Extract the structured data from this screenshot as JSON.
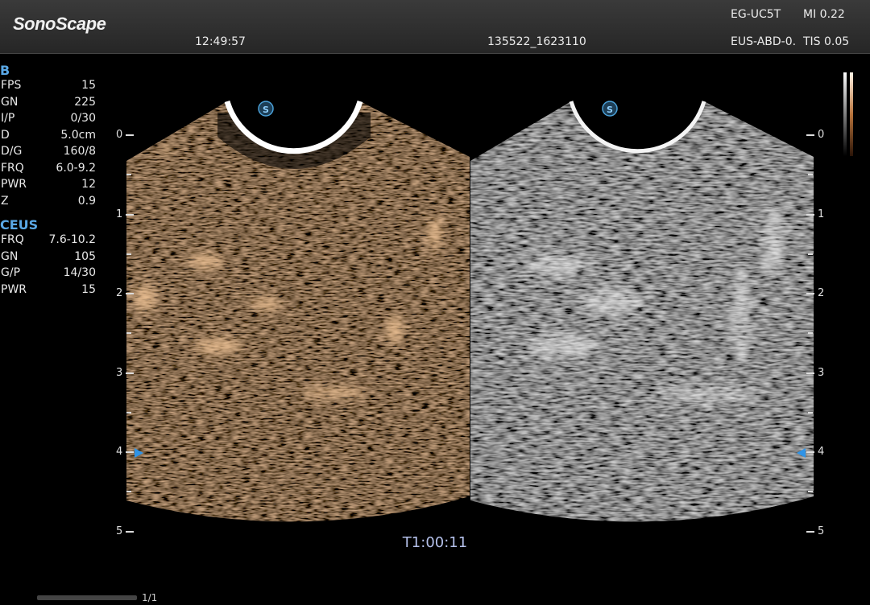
{
  "header": {
    "brand": "SonoScape",
    "time": "12:49:57",
    "patient_id": "135522_1623110",
    "probe": "EG-UC5T",
    "preset": "EUS-ABD-0.",
    "mi": "MI 0.22",
    "tis": "TIS 0.05"
  },
  "b_mode": {
    "title": "B",
    "params": [
      {
        "key": "FPS",
        "value": "15"
      },
      {
        "key": "GN",
        "value": "225"
      },
      {
        "key": "I/P",
        "value": "0/30"
      },
      {
        "key": "D",
        "value": "5.0cm"
      },
      {
        "key": "D/G",
        "value": "160/8"
      },
      {
        "key": "FRQ",
        "value": "6.0-9.2"
      },
      {
        "key": "PWR",
        "value": "12"
      },
      {
        "key": "Z",
        "value": "0.9"
      }
    ]
  },
  "ceus": {
    "title": "CEUS",
    "params": [
      {
        "key": "FRQ",
        "value": "7.6-10.2"
      },
      {
        "key": "GN",
        "value": "105"
      },
      {
        "key": "G/P",
        "value": "14/30"
      },
      {
        "key": "PWR",
        "value": "15"
      }
    ]
  },
  "depth_scale": {
    "labels": [
      "0",
      "1",
      "2",
      "3",
      "4",
      "5"
    ]
  },
  "image_badge": "S",
  "timer": "T1:00:11",
  "page_indicator": "1/1",
  "colors": {
    "accent_blue": "#5aa8e6",
    "ceus_tint": "#d8955a",
    "timer": "#b4c0ea"
  }
}
